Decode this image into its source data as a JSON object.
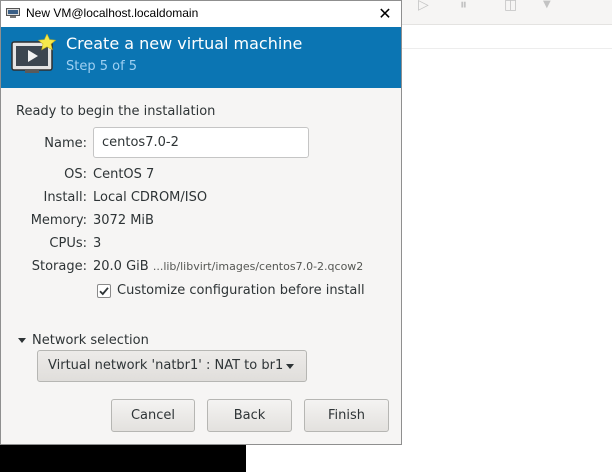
{
  "window": {
    "title": "New VM@localhost.localdomain",
    "close_glyph": "✕"
  },
  "wizard": {
    "title": "Create a new virtual machine",
    "step": "Step 5 of 5"
  },
  "summary": {
    "heading": "Ready to begin the installation",
    "name_label": "Name:",
    "name_value": "centos7.0-2",
    "os_label": "OS:",
    "os_value": "CentOS 7",
    "install_label": "Install:",
    "install_value": "Local CDROM/ISO",
    "memory_label": "Memory:",
    "memory_value": "3072 MiB",
    "cpus_label": "CPUs:",
    "cpus_value": "3",
    "storage_label": "Storage:",
    "storage_size": "20.0 GiB",
    "storage_path": "...lib/libvirt/images/centos7.0-2.qcow2",
    "customize_label": "Customize configuration before install",
    "customize_checked": true
  },
  "network": {
    "expander_label": "Network selection",
    "selected": "Virtual network 'natbr1' : NAT to br1"
  },
  "buttons": {
    "cancel": "Cancel",
    "back": "Back",
    "finish": "Finish"
  },
  "colors": {
    "header_bg": "#0b75b3",
    "header_title": "#ffffff",
    "header_step": "#9fd0f2",
    "dialog_bg": "#f6f5f4"
  },
  "icons": {
    "app": "virt-manager-icon",
    "header": "new-vm-monitor-icon",
    "close": "close-icon",
    "checkbox": "checkmark-icon",
    "expander": "expander-down-icon",
    "combo": "dropdown-arrow-icon"
  }
}
